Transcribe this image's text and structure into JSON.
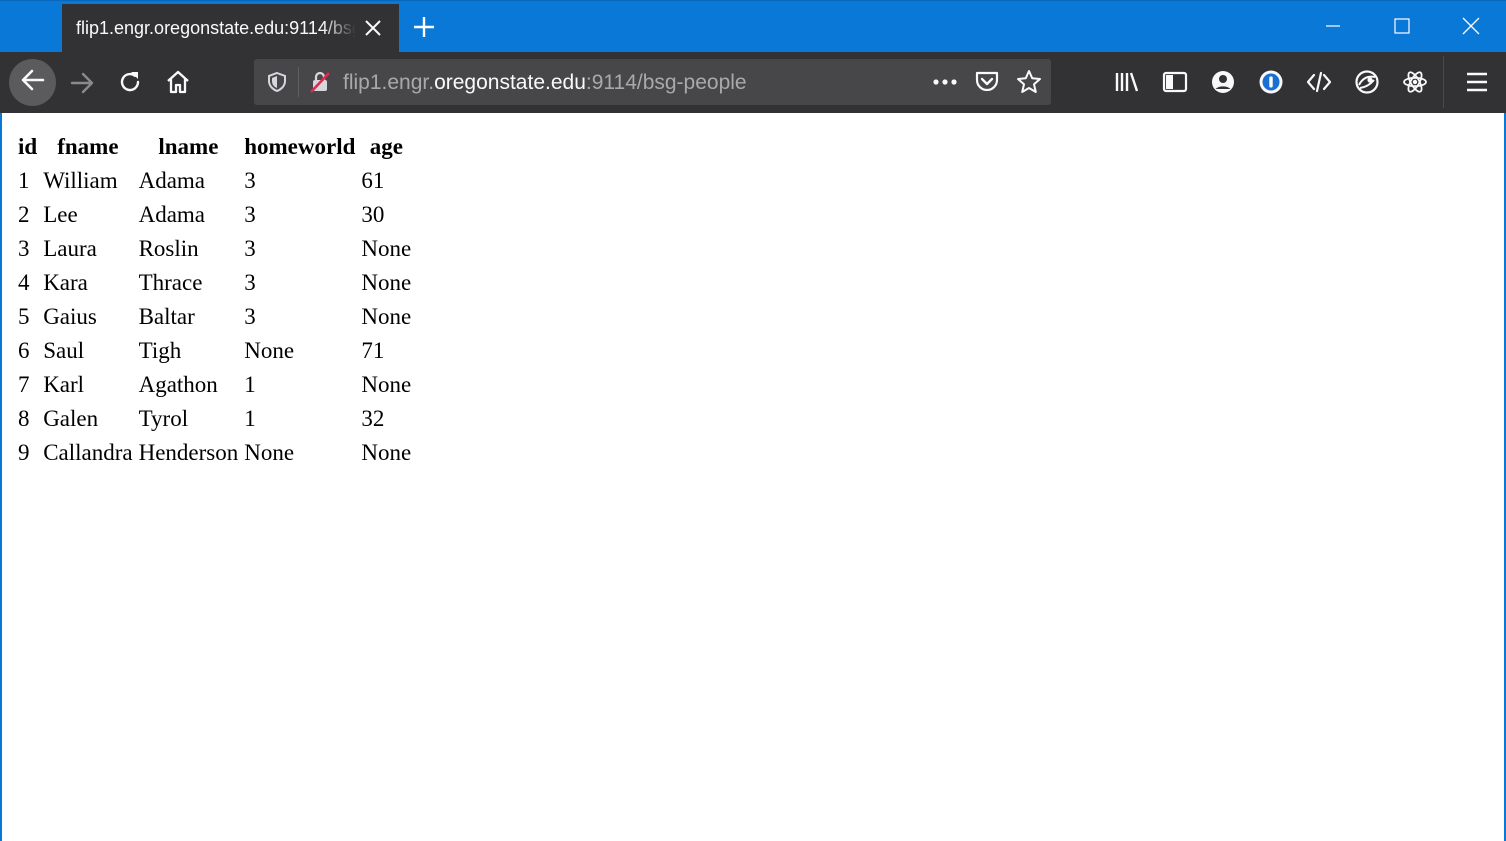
{
  "browser": {
    "tab_title": "flip1.engr.oregonstate.edu:9114/bsg-people",
    "url_scheme_host_prefix": "flip1.engr.",
    "url_domain": "oregonstate.edu",
    "url_rest": ":9114/bsg-people",
    "accent_color": "#0a78d7",
    "icons": [
      "close-icon",
      "plus-icon",
      "minimize-icon",
      "maximize-icon",
      "back-arrow-icon",
      "forward-arrow-icon",
      "reload-icon",
      "home-icon",
      "shield-icon",
      "insecure-lock-icon",
      "more-dots-icon",
      "pocket-icon",
      "star-icon",
      "library-icon",
      "sidebar-icon",
      "account-icon",
      "password-manager-icon",
      "devtools-icon",
      "extension-icon",
      "react-icon",
      "hamburger-menu-icon"
    ]
  },
  "table": {
    "headers": [
      "id",
      "fname",
      "lname",
      "homeworld",
      "age"
    ],
    "rows": [
      [
        "1",
        "William",
        "Adama",
        "3",
        "61"
      ],
      [
        "2",
        "Lee",
        "Adama",
        "3",
        "30"
      ],
      [
        "3",
        "Laura",
        "Roslin",
        "3",
        "None"
      ],
      [
        "4",
        "Kara",
        "Thrace",
        "3",
        "None"
      ],
      [
        "5",
        "Gaius",
        "Baltar",
        "3",
        "None"
      ],
      [
        "6",
        "Saul",
        "Tigh",
        "None",
        "71"
      ],
      [
        "7",
        "Karl",
        "Agathon",
        "1",
        "None"
      ],
      [
        "8",
        "Galen",
        "Tyrol",
        "1",
        "32"
      ],
      [
        "9",
        "Callandra",
        "Henderson",
        "None",
        "None"
      ]
    ]
  }
}
